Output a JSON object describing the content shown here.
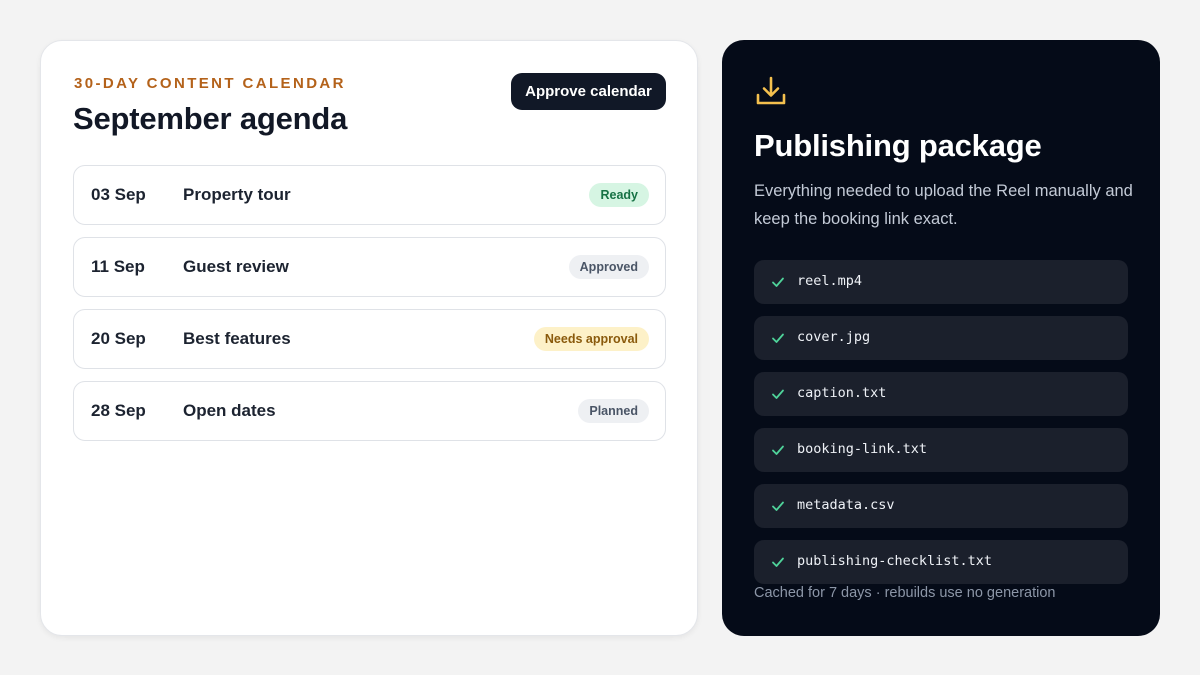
{
  "calendar": {
    "eyebrow": "30-DAY CONTENT CALENDAR",
    "title": "September agenda",
    "approve_label": "Approve calendar",
    "items": [
      {
        "date": "03 Sep",
        "topic": "Property tour",
        "status": "Ready",
        "status_bg": "#d6f5e3",
        "status_fg": "#177245"
      },
      {
        "date": "11 Sep",
        "topic": "Guest review",
        "status": "Approved",
        "status_bg": "#eef0f3",
        "status_fg": "#4a5566"
      },
      {
        "date": "20 Sep",
        "topic": "Best features",
        "status": "Needs approval",
        "status_bg": "#fdf1c8",
        "status_fg": "#8a5a0c"
      },
      {
        "date": "28 Sep",
        "topic": "Open dates",
        "status": "Planned",
        "status_bg": "#eef0f3",
        "status_fg": "#4a5566"
      }
    ]
  },
  "package": {
    "icon": "download-icon",
    "icon_color": "#f4c04e",
    "title": "Publishing package",
    "description": "Everything needed to upload the Reel manually and keep the booking link exact.",
    "files": [
      "reel.mp4",
      "cover.jpg",
      "caption.txt",
      "booking-link.txt",
      "metadata.csv",
      "publishing-checklist.txt"
    ],
    "check_color": "#4fd39a",
    "footer": "Cached for 7 days · rebuilds use no generation"
  },
  "colors": {
    "accent": "#b4621a",
    "dark_panel": "#050b18",
    "button": "#111827"
  }
}
